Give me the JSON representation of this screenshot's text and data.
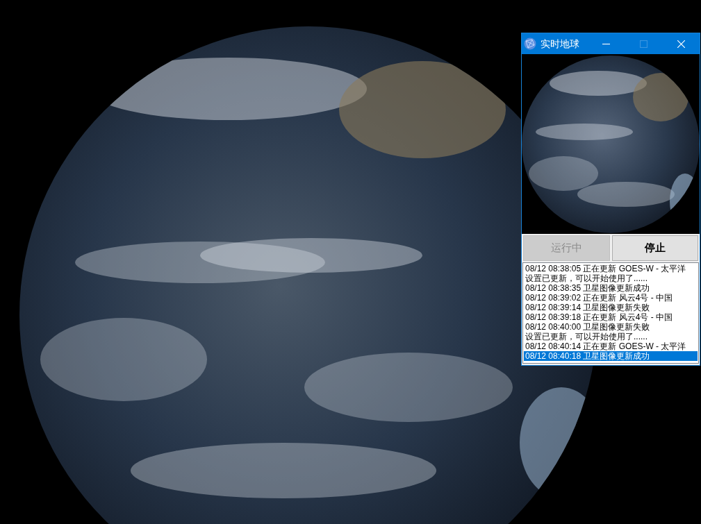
{
  "window": {
    "title": "实时地球",
    "title_buttons": [
      {
        "kind": "minimize",
        "disabled": false
      },
      {
        "kind": "maximize",
        "disabled": true
      },
      {
        "kind": "close",
        "disabled": false
      }
    ]
  },
  "buttons": [
    {
      "label": "运行中",
      "disabled": true
    },
    {
      "label": "停止",
      "disabled": false
    }
  ],
  "log": [
    {
      "text": "08/12 08:38:05 正在更新 GOES-W - 太平洋",
      "selected": false
    },
    {
      "text": "设置已更新，可以开始使用了......",
      "selected": false
    },
    {
      "text": "08/12 08:38:35 卫星图像更新成功",
      "selected": false
    },
    {
      "text": "08/12 08:39:02 正在更新 风云4号 - 中国",
      "selected": false
    },
    {
      "text": "08/12 08:39:14 卫星图像更新失败",
      "selected": false
    },
    {
      "text": "08/12 08:39:18 正在更新 风云4号 - 中国",
      "selected": false
    },
    {
      "text": "08/12 08:40:00 卫星图像更新失败",
      "selected": false
    },
    {
      "text": "设置已更新，可以开始使用了......",
      "selected": false
    },
    {
      "text": "08/12 08:40:14 正在更新 GOES-W - 太平洋",
      "selected": false
    },
    {
      "text": "08/12 08:40:18 卫星图像更新成功",
      "selected": true
    }
  ]
}
